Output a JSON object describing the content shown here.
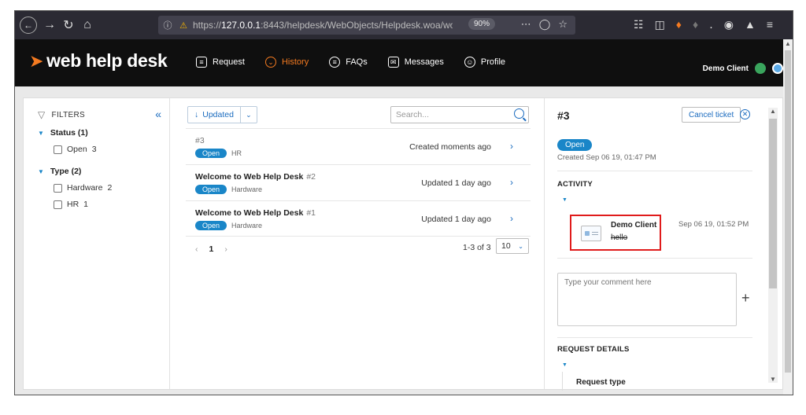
{
  "browser": {
    "url_prefix": "https://",
    "url_host": "127.0.0.1",
    "url_rest": ":8443/helpdesk/WebObjects/Helpdesk.woa/wo/64.5...",
    "zoom": "90%"
  },
  "app": {
    "logo": "web help desk",
    "nav": [
      {
        "label": "Request",
        "icon": "request-icon"
      },
      {
        "label": "History",
        "icon": "history-icon"
      },
      {
        "label": "FAQs",
        "icon": "faqs-icon"
      },
      {
        "label": "Messages",
        "icon": "messages-icon"
      },
      {
        "label": "Profile",
        "icon": "profile-icon"
      }
    ],
    "user_name": "Demo Client",
    "accent": "#f47a20",
    "primary": "#1a86c8"
  },
  "filters": {
    "title": "FILTERS",
    "groups": [
      {
        "title": "Status (1)",
        "items": [
          {
            "label": "Open",
            "count": "3"
          }
        ]
      },
      {
        "title": "Type (2)",
        "items": [
          {
            "label": "Hardware",
            "count": "2"
          },
          {
            "label": "HR",
            "count": "1"
          }
        ]
      }
    ]
  },
  "list": {
    "sort_label": "Updated",
    "search_placeholder": "Search...",
    "rows": [
      {
        "title": "",
        "num": "#3",
        "badge": "Open",
        "tag": "HR",
        "status": "Created moments ago"
      },
      {
        "title": "Welcome to Web Help Desk",
        "num": "#2",
        "badge": "Open",
        "tag": "Hardware",
        "status": "Updated 1 day ago"
      },
      {
        "title": "Welcome to Web Help Desk",
        "num": "#1",
        "badge": "Open",
        "tag": "Hardware",
        "status": "Updated 1 day ago"
      }
    ],
    "current_page": "1",
    "page_count": "1-3 of 3",
    "page_size": "10"
  },
  "detail": {
    "ticket_id": "#3",
    "cancel_label": "Cancel ticket",
    "status_badge": "Open",
    "created": "Created Sep 06 19, 01:47 PM",
    "activity_title": "ACTIVITY",
    "activity": {
      "name": "Demo Client",
      "text": "hello",
      "time": "Sep 06 19, 01:52 PM"
    },
    "comment_placeholder": "Type your comment here",
    "request_details_title": "REQUEST DETAILS",
    "request_type_label": "Request type"
  }
}
